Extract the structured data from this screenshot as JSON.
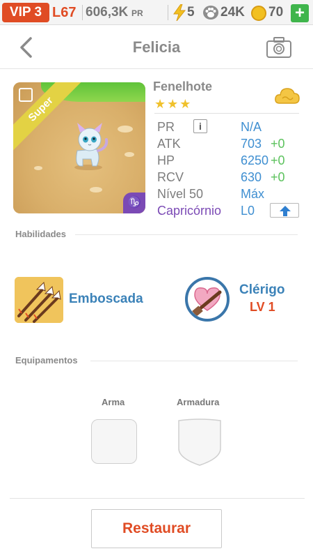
{
  "status_bar": {
    "vip": "VIP 3",
    "level": "L67",
    "power_value": "606,3K",
    "power_label": "PR",
    "energy": "5",
    "food": "24K",
    "coins": "70",
    "add": "+",
    "icons": [
      "bolt-icon",
      "paw-icon",
      "coin-icon",
      "plus-icon"
    ]
  },
  "nav": {
    "title": "Felicia",
    "icons": [
      "back-arrow-icon",
      "camera-icon"
    ]
  },
  "pet": {
    "name": "Fenelhote",
    "stars": "★★★",
    "rarity": "Super",
    "zodiac_symbol": "♑",
    "stats": {
      "pr_label": "PR",
      "pr_info": "i",
      "pr_value": "N/A",
      "atk_label": "ATK",
      "atk_value": "703",
      "atk_bonus": "+0",
      "hp_label": "HP",
      "hp_value": "6250",
      "hp_bonus": "+0",
      "rcv_label": "RCV",
      "rcv_value": "630",
      "rcv_bonus": "+0",
      "level_label": "Nível 50",
      "level_value": "Máx",
      "zodiac_label": "Capricórnio",
      "zodiac_value": "L0"
    }
  },
  "skills": {
    "title": "Habilidades",
    "skill1_name": "Emboscada",
    "skill2_name": "Clérigo",
    "skill2_level": "LV 1"
  },
  "equipment": {
    "title": "Equipamentos",
    "weapon_label": "Arma",
    "armor_label": "Armadura"
  },
  "actions": {
    "restore": "Restaurar"
  },
  "colors": {
    "accent": "#e04c24",
    "link": "#3b82b8",
    "value": "#3f8fd1",
    "bonus": "#5cc25d",
    "zodiac": "#7b4ab5"
  }
}
